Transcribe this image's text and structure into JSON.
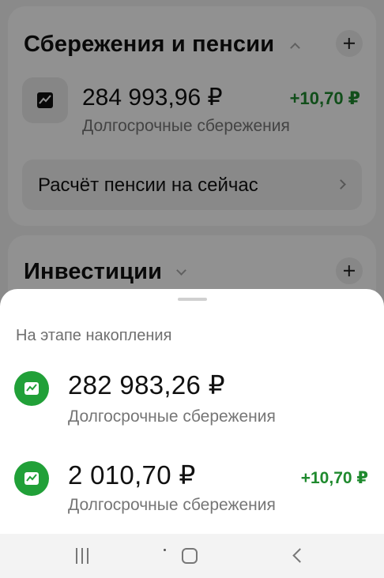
{
  "background": {
    "savings_section": {
      "title": "Сбережения и пенсии",
      "account": {
        "amount": "284 993,96 ₽",
        "subtitle": "Долгосрочные сбережения",
        "change": "+10,70 ₽"
      },
      "pension_row_label": "Расчёт пенсии на сейчас"
    },
    "investments_section": {
      "title": "Инвестиции"
    }
  },
  "sheet": {
    "header": "На этапе накопления",
    "items": [
      {
        "amount": "282 983,26 ₽",
        "subtitle": "Долгосрочные сбережения",
        "change": ""
      },
      {
        "amount": "2 010,70 ₽",
        "subtitle": "Долгосрочные сбережения",
        "change": "+10,70 ₽"
      }
    ]
  },
  "colors": {
    "accent_green": "#21a038",
    "positive_change": "#1f8a2e"
  },
  "icons": {
    "account": "chart-trend-icon",
    "expand": "chevron-up-icon",
    "collapse": "chevron-down-icon",
    "add": "plus-icon",
    "row_arrow": "chevron-right-icon"
  }
}
